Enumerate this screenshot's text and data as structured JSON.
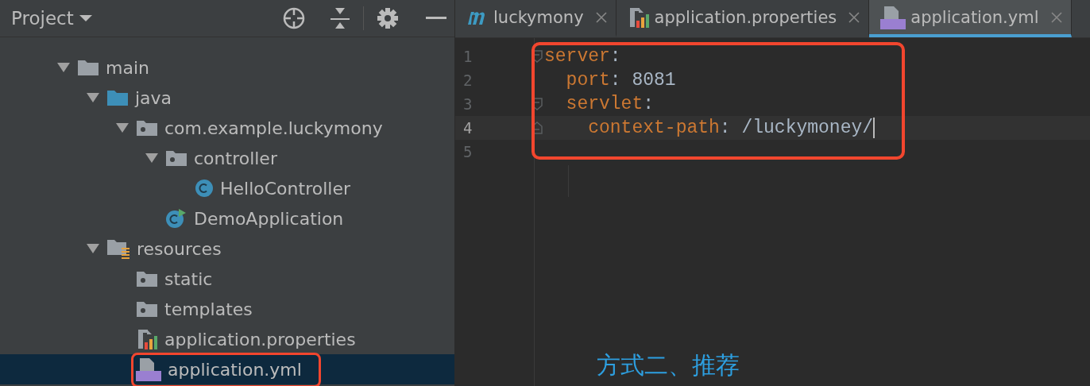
{
  "project_panel": {
    "title": "Project",
    "tree": [
      {
        "label": "main",
        "kind": "folder",
        "expanded": true,
        "selected": false,
        "highlighted": false,
        "children": [
          {
            "label": "java",
            "kind": "source-folder",
            "expanded": true,
            "selected": false,
            "highlighted": false,
            "children": [
              {
                "label": "com.example.luckymony",
                "kind": "package",
                "expanded": true,
                "selected": false,
                "highlighted": false,
                "children": [
                  {
                    "label": "controller",
                    "kind": "package",
                    "expanded": true,
                    "selected": false,
                    "highlighted": false,
                    "children": [
                      {
                        "label": "HelloController",
                        "kind": "class",
                        "selected": false,
                        "highlighted": false
                      }
                    ]
                  },
                  {
                    "label": "DemoApplication",
                    "kind": "app-class",
                    "selected": false,
                    "highlighted": false
                  }
                ]
              }
            ]
          },
          {
            "label": "resources",
            "kind": "resource-folder",
            "expanded": true,
            "selected": false,
            "highlighted": false,
            "children": [
              {
                "label": "static",
                "kind": "package",
                "selected": false,
                "highlighted": false
              },
              {
                "label": "templates",
                "kind": "package",
                "selected": false,
                "highlighted": false
              },
              {
                "label": "application.properties",
                "kind": "properties",
                "selected": false,
                "highlighted": false
              },
              {
                "label": "application.yml",
                "kind": "yml",
                "selected": true,
                "highlighted": true
              }
            ]
          }
        ]
      }
    ]
  },
  "editor": {
    "tabs": [
      {
        "label": "luckymony",
        "kind": "module",
        "selected": false
      },
      {
        "label": "application.properties",
        "kind": "properties",
        "selected": false
      },
      {
        "label": "application.yml",
        "kind": "yml",
        "selected": true
      }
    ],
    "highlighted": true,
    "lines": [
      {
        "number": "1",
        "kind": "fold-start",
        "current": false,
        "tokens": [
          {
            "kind": "key",
            "text": "server"
          },
          {
            "kind": "punct",
            "text": ":"
          }
        ]
      },
      {
        "number": "2",
        "kind": "plain",
        "current": false,
        "tokens": [
          {
            "kind": "key",
            "text": "  port"
          },
          {
            "kind": "punct",
            "text": ": "
          },
          {
            "kind": "value",
            "text": "8081"
          }
        ]
      },
      {
        "number": "3",
        "kind": "fold-start",
        "current": false,
        "tokens": [
          {
            "kind": "key",
            "text": "  servlet"
          },
          {
            "kind": "punct",
            "text": ":"
          }
        ]
      },
      {
        "number": "4",
        "kind": "fold-end",
        "current": true,
        "tokens": [
          {
            "kind": "key",
            "text": "    context-path"
          },
          {
            "kind": "punct",
            "text": ": "
          },
          {
            "kind": "value",
            "text": "/luckymoney/"
          }
        ]
      },
      {
        "number": "5",
        "kind": "plain",
        "current": false
      }
    ],
    "annotation": "方式二、推荐"
  }
}
